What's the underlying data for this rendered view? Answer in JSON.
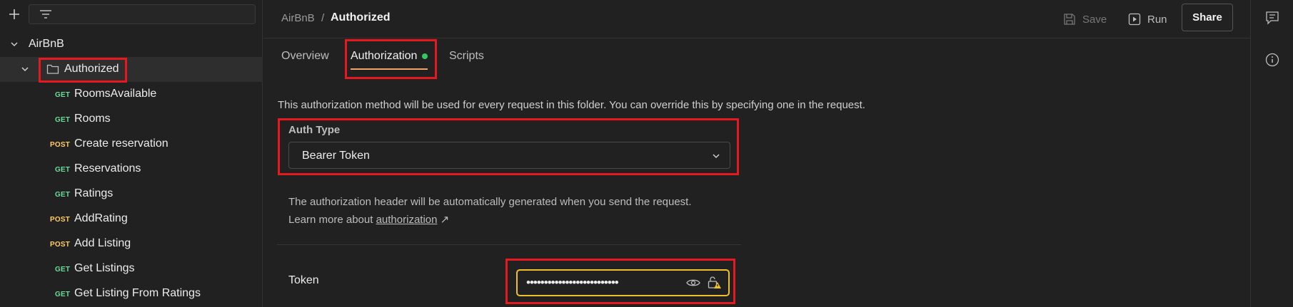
{
  "sidebar": {
    "collection": "AirBnB",
    "folder": "Authorized",
    "requests": [
      {
        "method": "GET",
        "name": "RoomsAvailable"
      },
      {
        "method": "GET",
        "name": "Rooms"
      },
      {
        "method": "POST",
        "name": "Create reservation"
      },
      {
        "method": "GET",
        "name": "Reservations"
      },
      {
        "method": "GET",
        "name": "Ratings"
      },
      {
        "method": "POST",
        "name": "AddRating"
      },
      {
        "method": "POST",
        "name": "Add Listing"
      },
      {
        "method": "GET",
        "name": "Get Listings"
      },
      {
        "method": "GET",
        "name": "Get Listing From Ratings"
      }
    ]
  },
  "header": {
    "breadcrumb_parent": "AirBnB",
    "breadcrumb_sep": "/",
    "breadcrumb_current": "Authorized",
    "save_label": "Save",
    "run_label": "Run",
    "share_label": "Share"
  },
  "tabs": [
    {
      "label": "Overview"
    },
    {
      "label": "Authorization"
    },
    {
      "label": "Scripts"
    }
  ],
  "auth": {
    "info": "This authorization method will be used for every request in this folder. You can override this by specifying one in the request.",
    "type_label": "Auth Type",
    "type_value": "Bearer Token",
    "desc_line1": "The authorization header will be automatically generated when you send the request.",
    "desc_prefix": "Learn more about ",
    "desc_link": "authorization",
    "desc_arrow": "↗",
    "token_label": "Token",
    "token_value": "••••••••••••••••••••••••••"
  },
  "colors": {
    "get": "#6bdd9a",
    "post": "#ffcc66",
    "highlight": "#e5191f",
    "token_border": "#f0c02c",
    "tab_underline": "#f2a36b",
    "status_dot": "#2fcb5e"
  },
  "icons": [
    "plus-icon",
    "filter-icon",
    "chevron-down-icon",
    "folder-icon",
    "save-icon",
    "run-icon",
    "eye-icon",
    "lock-warning-icon",
    "comments-icon",
    "info-icon"
  ]
}
